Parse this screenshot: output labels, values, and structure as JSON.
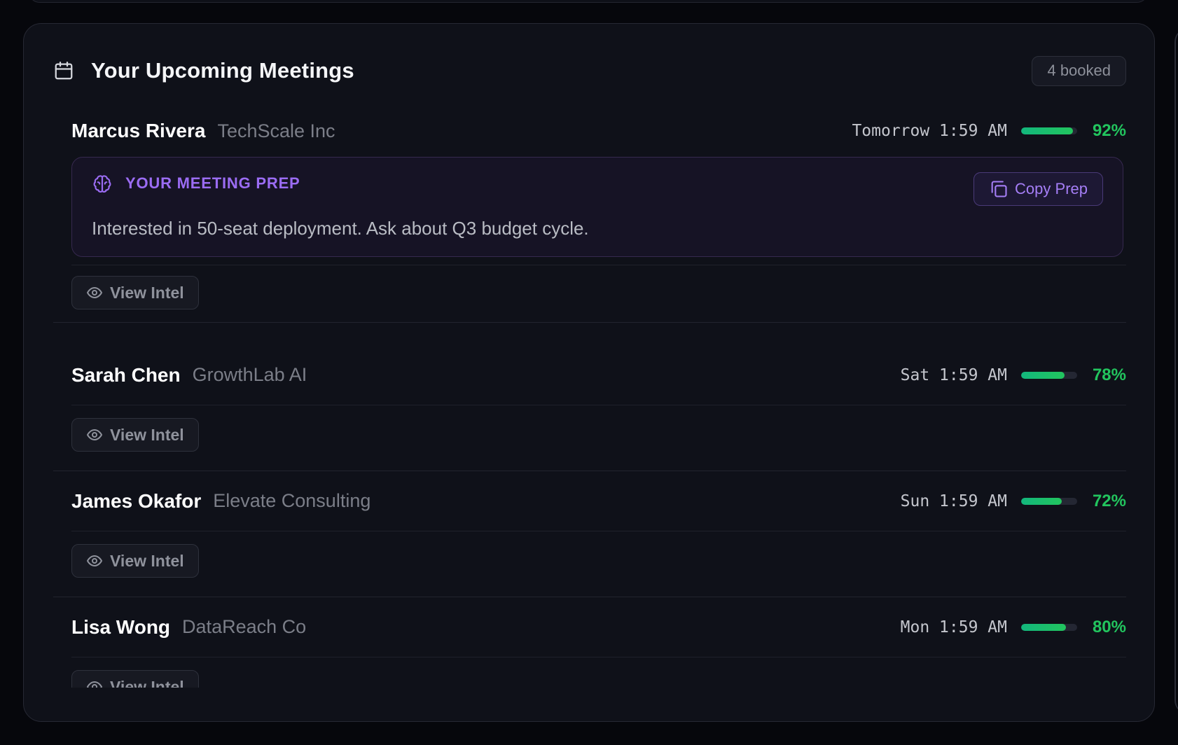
{
  "header": {
    "title": "Your Upcoming Meetings",
    "booked_badge": "4 booked",
    "icon": "calendar-icon"
  },
  "prep": {
    "title": "YOUR MEETING PREP",
    "copy_label": "Copy Prep",
    "text": "Interested in 50-seat deployment. Ask about Q3 budget cycle.",
    "icon": "brain-icon",
    "accent_color": "#9b6cf3"
  },
  "meetings": [
    {
      "name": "Marcus Rivera",
      "company": "TechScale Inc",
      "time": "Tomorrow 1:59 AM",
      "score_label": "92%",
      "score": 92,
      "action_label": "View Intel"
    },
    {
      "name": "Sarah Chen",
      "company": "GrowthLab AI",
      "time": "Sat 1:59 AM",
      "score_label": "78%",
      "score": 78,
      "action_label": "View Intel"
    },
    {
      "name": "James Okafor",
      "company": "Elevate Consulting",
      "time": "Sun 1:59 AM",
      "score_label": "72%",
      "score": 72,
      "action_label": "View Intel"
    },
    {
      "name": "Lisa Wong",
      "company": "DataReach Co",
      "time": "Mon 1:59 AM",
      "score_label": "80%",
      "score": 80,
      "action_label": "View Intel"
    }
  ],
  "colors": {
    "score_green": "#22c55e",
    "background": "#0f1119"
  }
}
